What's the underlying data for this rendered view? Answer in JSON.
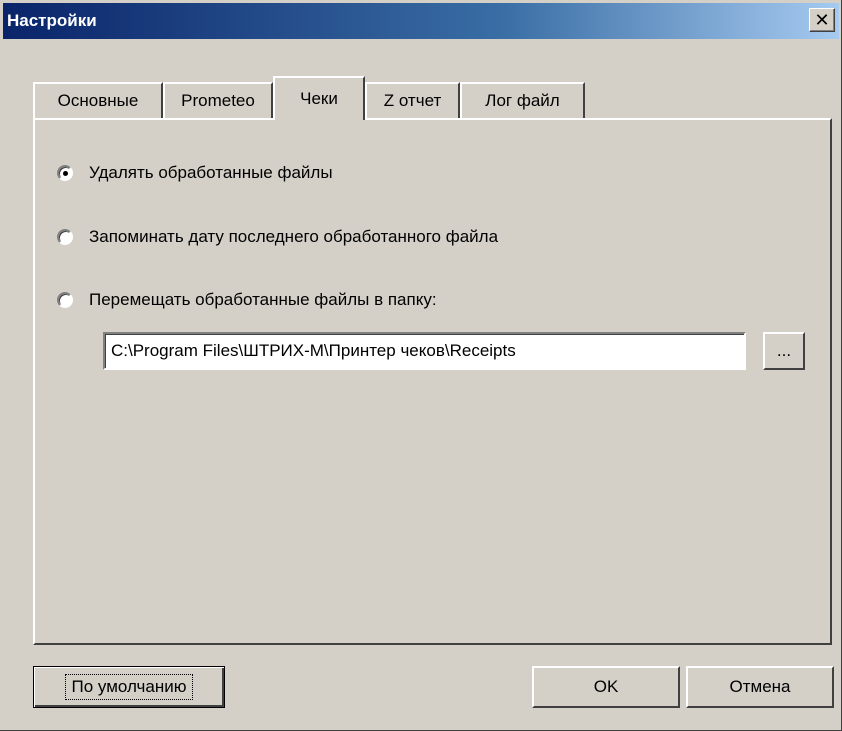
{
  "window": {
    "title": "Настройки",
    "close_label": "✕"
  },
  "tabs": [
    {
      "label": "Основные",
      "active": false
    },
    {
      "label": "Prometeo",
      "active": false
    },
    {
      "label": "Чеки",
      "active": true
    },
    {
      "label": "Z отчет",
      "active": false
    },
    {
      "label": "Лог файл",
      "active": false
    }
  ],
  "receipts": {
    "options": [
      {
        "label": "Удалять обработанные файлы",
        "checked": true
      },
      {
        "label": "Запоминать дату последнего обработанного файла",
        "checked": false
      },
      {
        "label": "Перемещать обработанные файлы в папку:",
        "checked": false
      }
    ],
    "folder_path": "C:\\Program Files\\ШТРИХ-М\\Принтер чеков\\Receipts",
    "browse_label": "..."
  },
  "buttons": {
    "defaults_label": "По умолчанию",
    "ok_label": "OK",
    "cancel_label": "Отмена"
  },
  "colors": {
    "titlebar_start": "#0a246a",
    "titlebar_end": "#a6caf0",
    "face": "#d4d0c8"
  }
}
